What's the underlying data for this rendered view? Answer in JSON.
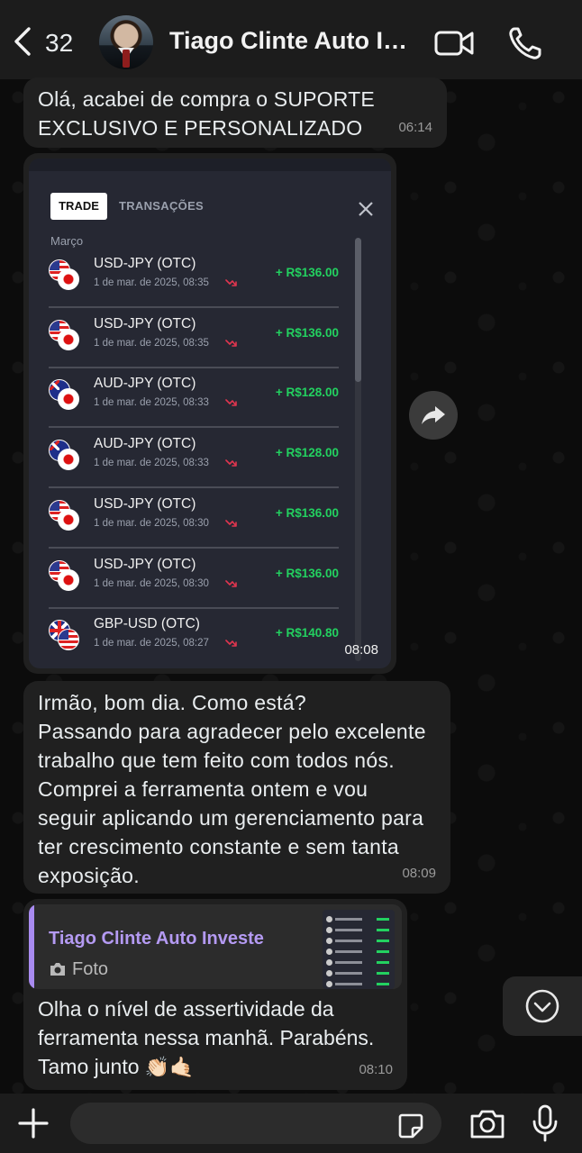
{
  "header": {
    "unread_count": "32",
    "contact_name": "Tiago Clinte Auto Investe"
  },
  "messages": {
    "m1": {
      "text": "Olá, acabei de compra o SUPORTE EXCLUSIVO E PERSONALIZADO",
      "time": "06:14"
    },
    "image": {
      "time": "08:08",
      "tabs": {
        "trade": "TRADE",
        "transactions": "TRANSAÇÕES"
      },
      "month": "Março",
      "trades": [
        {
          "pair": "USD-JPY (OTC)",
          "date": "1 de mar. de 2025, 08:35",
          "amount": "+ R$136.00",
          "flag_a": "us",
          "flag_b": "jp"
        },
        {
          "pair": "USD-JPY (OTC)",
          "date": "1 de mar. de 2025, 08:35",
          "amount": "+ R$136.00",
          "flag_a": "us",
          "flag_b": "jp"
        },
        {
          "pair": "AUD-JPY (OTC)",
          "date": "1 de mar. de 2025, 08:33",
          "amount": "+ R$128.00",
          "flag_a": "au",
          "flag_b": "jp"
        },
        {
          "pair": "AUD-JPY (OTC)",
          "date": "1 de mar. de 2025, 08:33",
          "amount": "+ R$128.00",
          "flag_a": "au",
          "flag_b": "jp"
        },
        {
          "pair": "USD-JPY (OTC)",
          "date": "1 de mar. de 2025, 08:30",
          "amount": "+ R$136.00",
          "flag_a": "us",
          "flag_b": "jp"
        },
        {
          "pair": "USD-JPY (OTC)",
          "date": "1 de mar. de 2025, 08:30",
          "amount": "+ R$136.00",
          "flag_a": "us",
          "flag_b": "jp"
        },
        {
          "pair": "GBP-USD (OTC)",
          "date": "1 de mar. de 2025, 08:27",
          "amount": "+ R$140.80",
          "flag_a": "gb",
          "flag_b": "us"
        }
      ]
    },
    "m3": {
      "lines": [
        "Irmão, bom dia. Como está?",
        "Passando para agradecer pelo excelente",
        "trabalho que tem feito com todos nós.",
        "Comprei a ferramenta ontem e vou",
        "seguir aplicando um gerenciamento para",
        "ter crescimento constante e sem tanta",
        "exposição."
      ],
      "time": "08:09"
    },
    "m4": {
      "quote_author": "Tiago Clinte Auto Investe",
      "quote_kind": "Foto",
      "lines": [
        "Olha o nível de assertividade da",
        "ferramenta nessa manhã. Parabéns.",
        "Tamo junto"
      ],
      "emojis": "👏🏻🤙🏻",
      "time": "08:10"
    }
  },
  "input": {
    "value": "",
    "placeholder": ""
  },
  "colors": {
    "background": "#0b0b0b",
    "bubble": "#202020",
    "accent_quote": "#a98bf0",
    "profit_green": "#23d160"
  },
  "icons": [
    "back-chevron-icon",
    "video-call-icon",
    "phone-icon",
    "forward-icon",
    "scroll-down-icon",
    "plus-icon",
    "sticker-icon",
    "camera-icon",
    "mic-icon"
  ]
}
